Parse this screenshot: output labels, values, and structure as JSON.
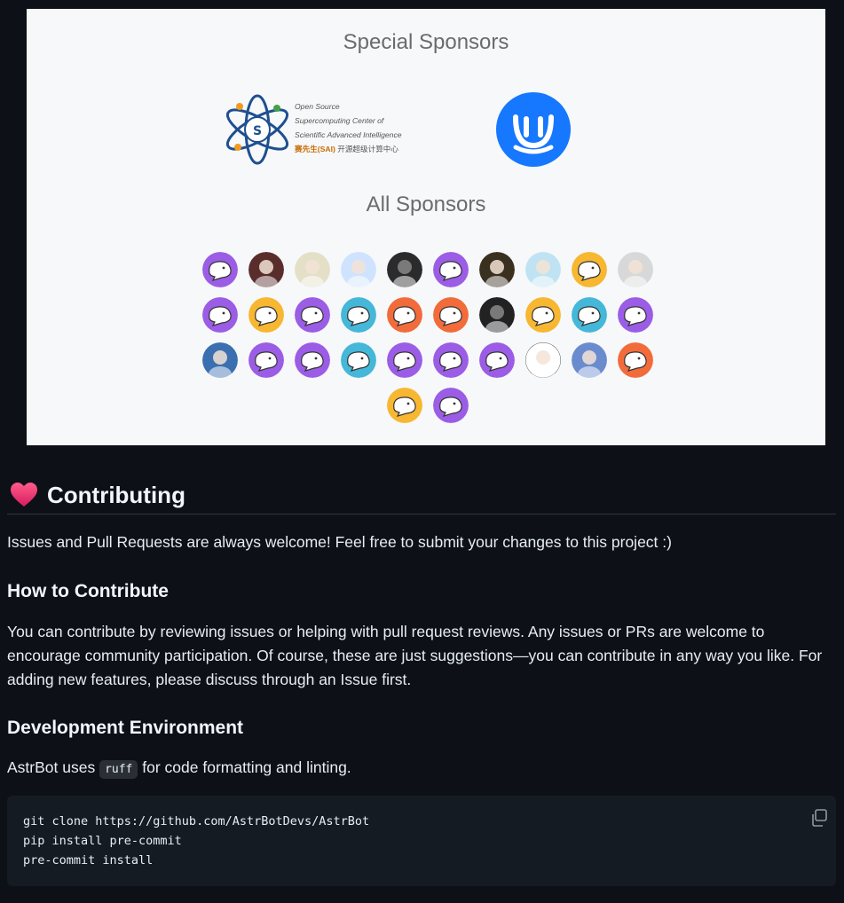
{
  "sponsors": {
    "special_title": "Special Sponsors",
    "all_title": "All Sponsors",
    "sai": {
      "line1": "Open Source",
      "line2": "Supercomputing Center of",
      "line3": "Scientific Advanced Intelligence",
      "line4_cn": "赛先生(SAI)",
      "line4_grey": " 开源超级计算中心"
    },
    "avatar_colors": [
      "#9b5de5",
      "#5a2d2d",
      "#e4e0c8",
      "#cfe3ff",
      "#2b2b2b",
      "#9b5de5",
      "#3a3020",
      "#bfe3f2",
      "#f7b731",
      "#d8d8d8",
      "#9b5de5",
      "#f7b731",
      "#9b5de5",
      "#45b7d8",
      "#f26b3a",
      "#f26b3a",
      "#222222",
      "#f7b731",
      "#45b7d8",
      "#9b5de5",
      "#3a6fb0",
      "#9b5de5",
      "#9b5de5",
      "#45b7d8",
      "#9b5de5",
      "#9b5de5",
      "#9b5de5",
      "#ffffff",
      "#6a8ccf",
      "#f26b3a",
      "#f7b731",
      "#9b5de5"
    ]
  },
  "contributing": {
    "heading": "Contributing",
    "intro": "Issues and Pull Requests are always welcome! Feel free to submit your changes to this project :)",
    "how_heading": "How to Contribute",
    "how_text": "You can contribute by reviewing issues or helping with pull request reviews. Any issues or PRs are welcome to encourage community participation. Of course, these are just suggestions—you can contribute in any way you like. For adding new features, please discuss through an Issue first.",
    "dev_heading": "Development Environment",
    "dev_prefix": "AstrBot uses ",
    "dev_code": "ruff",
    "dev_suffix": " for code formatting and linting.",
    "code_lines": "git clone https://github.com/AstrBotDevs/AstrBot\npip install pre-commit\npre-commit install"
  }
}
